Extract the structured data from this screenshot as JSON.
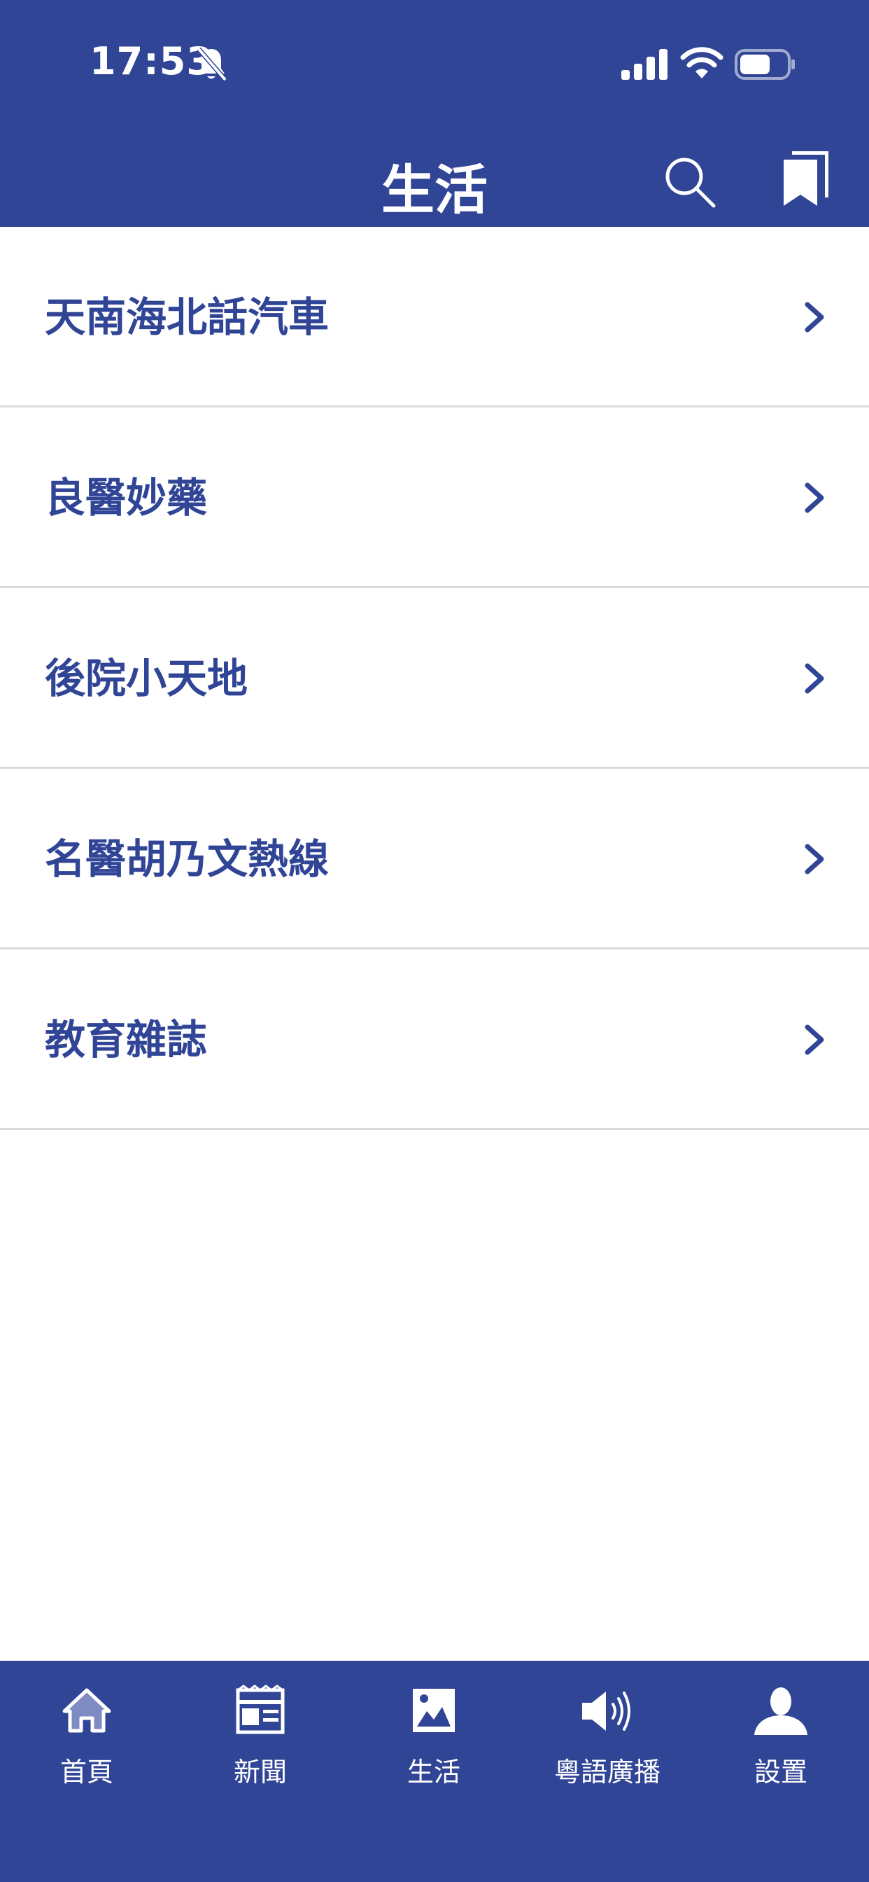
{
  "status_bar": {
    "time": "17:53"
  },
  "header": {
    "title": "生活"
  },
  "list": {
    "items": [
      {
        "label": "天南海北話汽車"
      },
      {
        "label": "良醫妙藥"
      },
      {
        "label": "後院小天地"
      },
      {
        "label": "名醫胡乃文熱線"
      },
      {
        "label": "教育雜誌"
      }
    ]
  },
  "tabbar": {
    "items": [
      {
        "label": "首頁",
        "icon": "home-icon"
      },
      {
        "label": "新聞",
        "icon": "newspaper-icon"
      },
      {
        "label": "生活",
        "icon": "image-icon"
      },
      {
        "label": "粵語廣播",
        "icon": "speaker-icon"
      },
      {
        "label": "設置",
        "icon": "person-icon"
      }
    ]
  },
  "colors": {
    "brand": "#314597",
    "divider": "#d8dade",
    "background": "#ffffff"
  }
}
